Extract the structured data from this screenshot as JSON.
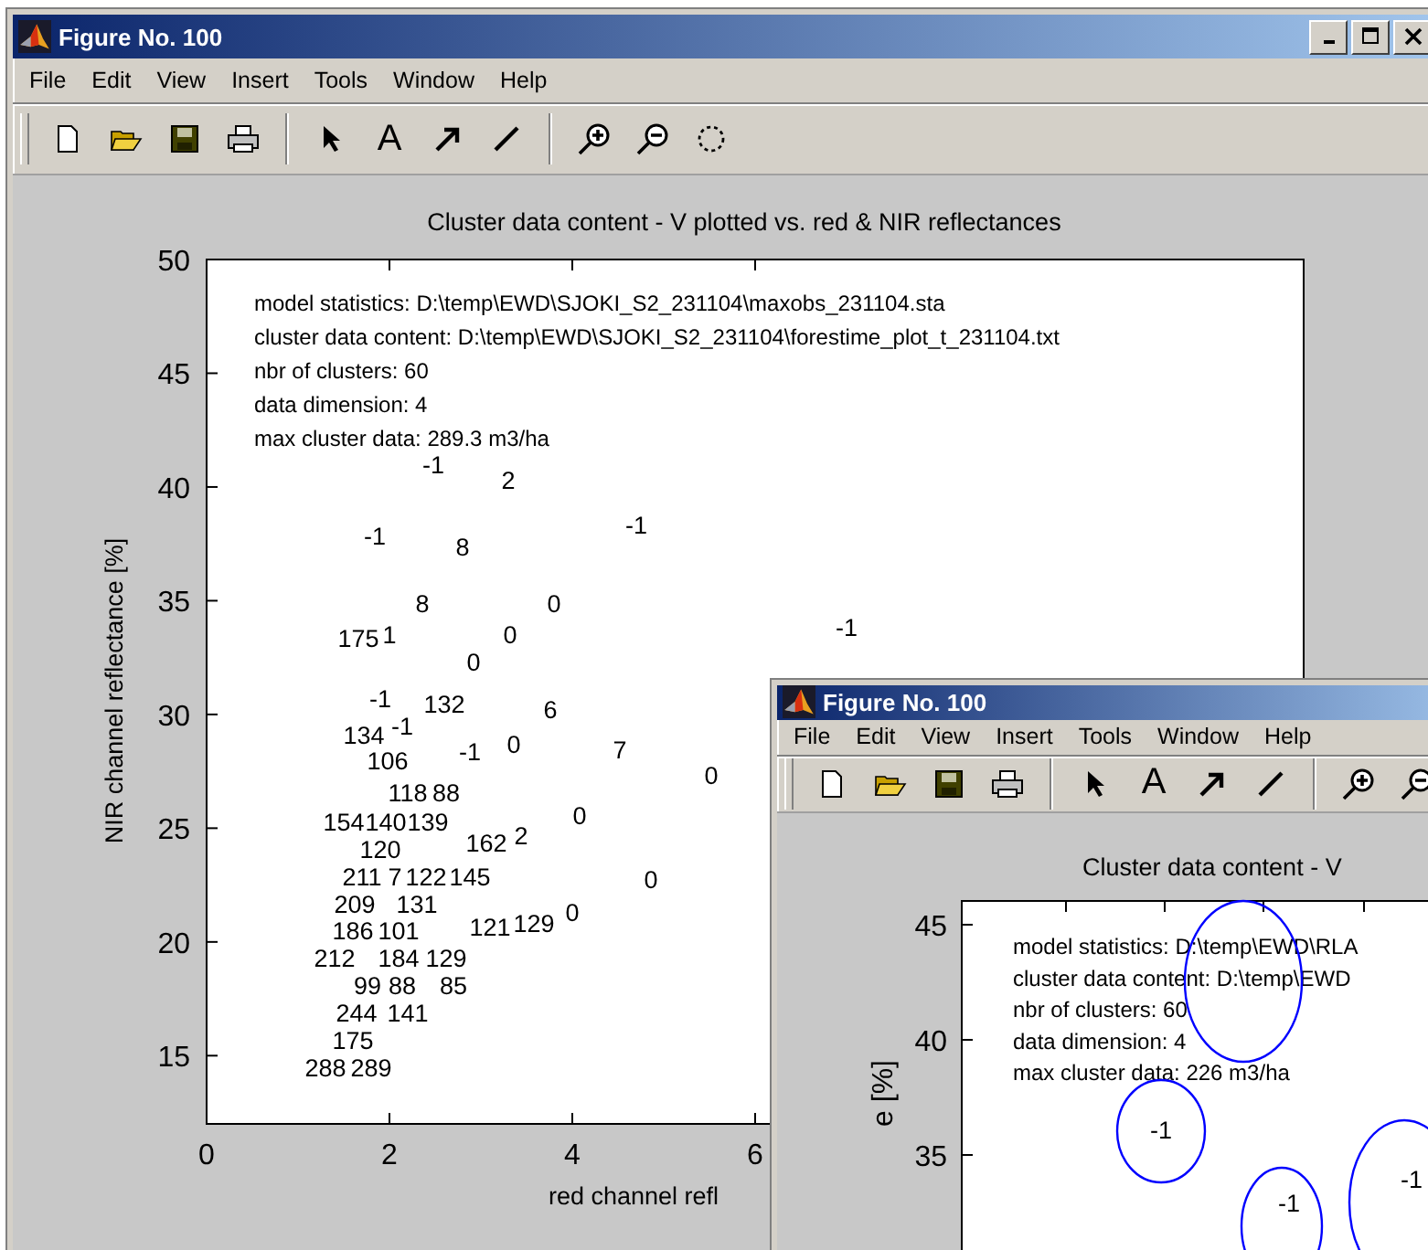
{
  "windows": [
    {
      "kind": "main",
      "title": "Figure No. 100",
      "menu": [
        "File",
        "Edit",
        "View",
        "Insert",
        "Tools",
        "Window",
        "Help"
      ],
      "toolbar": [
        {
          "kind": "new"
        },
        {
          "kind": "open"
        },
        {
          "kind": "save"
        },
        {
          "kind": "print"
        },
        {
          "kind": "separator"
        },
        {
          "kind": "select"
        },
        {
          "kind": "text",
          "label": "A"
        },
        {
          "kind": "arrow"
        },
        {
          "kind": "line"
        },
        {
          "kind": "separator"
        },
        {
          "kind": "zoom-in"
        },
        {
          "kind": "zoom-out"
        },
        {
          "kind": "rotate"
        }
      ],
      "plot": {
        "info_lines": [
          "model statistics: D:\\temp\\EWD\\SJOKI_S2_231104\\maxobs_231104.sta",
          "cluster data content: D:\\temp\\EWD\\SJOKI_S2_231104\\forestime_plot_t_231104.txt",
          "nbr of clusters: 60",
          "data dimension: 4",
          "max cluster data: 289.3 m3/ha"
        ],
        "chart_data": {
          "type": "scatter",
          "title": "Cluster data content - V plotted vs. red & NIR reflectances",
          "xlabel": "red channel refl",
          "ylabel": "NIR channel reflectance [%]",
          "xlim": [
            0,
            12
          ],
          "ylim": [
            12,
            50
          ],
          "xticks": [
            0,
            2,
            4,
            6
          ],
          "yticks": [
            15,
            20,
            25,
            30,
            35,
            40,
            45,
            50
          ],
          "annotations": [
            "-1",
            "2",
            "-1",
            "8",
            "-1",
            "8",
            "0",
            "-1",
            "175",
            "1",
            "0",
            "0",
            "-1",
            "132",
            "6",
            "134",
            "-1",
            "-1",
            "0",
            "7",
            "0",
            "106",
            "118",
            "88",
            "154",
            "140",
            "139",
            "120",
            "162",
            "2",
            "0",
            "0",
            "211",
            "7",
            "122",
            "145",
            "209",
            "131",
            "186",
            "101",
            "0",
            "121",
            "129",
            "184",
            "129",
            "85",
            "212",
            "99",
            "88",
            "141",
            "244",
            "175",
            "288",
            "289"
          ]
        }
      }
    },
    {
      "kind": "inset",
      "title": "Figure No. 100",
      "menu": [
        "File",
        "Edit",
        "View",
        "Insert",
        "Tools",
        "Window",
        "Help"
      ],
      "toolbar": [
        {
          "kind": "new"
        },
        {
          "kind": "open"
        },
        {
          "kind": "save"
        },
        {
          "kind": "print"
        },
        {
          "kind": "separator"
        },
        {
          "kind": "select"
        },
        {
          "kind": "text",
          "label": "A"
        },
        {
          "kind": "arrow"
        },
        {
          "kind": "line"
        },
        {
          "kind": "separator"
        },
        {
          "kind": "zoom-in"
        },
        {
          "kind": "zoom-out"
        }
      ],
      "plot": {
        "title": "Cluster data content - V",
        "ylabel": "e [%]",
        "yticks": [
          "45",
          "40",
          "35"
        ],
        "info_lines": [
          "model statistics: D:\\temp\\EWD\\RLA",
          "cluster data content: D:\\temp\\EWD",
          "nbr of clusters: 60",
          "data dimension: 4",
          "max cluster data: 226 m3/ha"
        ],
        "cluster_labels": [
          "-1",
          "-1",
          "-1"
        ]
      }
    }
  ]
}
